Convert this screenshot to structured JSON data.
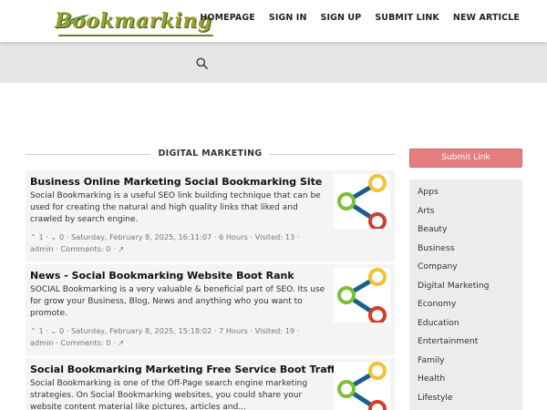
{
  "logo": {
    "text": "Bookmarking"
  },
  "nav": {
    "items": [
      "HOMEPAGE",
      "SIGN IN",
      "SIGN UP",
      "SUBMIT LINK",
      "NEW ARTICLE"
    ]
  },
  "section_title": "DIGITAL MARKETING",
  "posts": [
    {
      "title": "Business Online Marketing Social Bookmarking Site",
      "description": "Social Bookmarking is a useful SEO link building technique that can be used for creating the natural and high quality links that liked and crawled by search engine.",
      "upvotes": "1",
      "downvotes": "0",
      "date": "Saturday, February 8, 2025, 16:11:07",
      "ago": "6 Hours",
      "visited": "Visited: 13",
      "author": "admin",
      "comments": "Comments: 0"
    },
    {
      "title": "News - Social Bookmarking Website Boot Rank",
      "description": "SOCIAL Bookmarking is a very valuable & beneficial part of SEO. Its use for grow your Business, Blog, News and anything who you want to promote.",
      "upvotes": "1",
      "downvotes": "0",
      "date": "Saturday, February 8, 2025, 15:18:02",
      "ago": "7 Hours",
      "visited": "Visited: 19",
      "author": "admin",
      "comments": "Comments: 0"
    },
    {
      "title": "Social Bookmarking Marketing Free Service Boot Traffic",
      "description": "Social Bookmarking is one of the Off-Page search engine marketing strategies. On Social Bookmarking websites, you could share your website content material like pictures, articles and..."
    }
  ],
  "sidebar": {
    "submit_label": "Submit Link",
    "categories": [
      "Apps",
      "Arts",
      "Beauty",
      "Business",
      "Company",
      "Digital Marketing",
      "Economy",
      "Education",
      "Entertainment",
      "Family",
      "Health",
      "Lifestyle"
    ]
  },
  "colors": {
    "submit_button": "#e47f80",
    "logo": "#9aa02a",
    "band": "#e6e6e6",
    "card": "#f4f4f4"
  }
}
